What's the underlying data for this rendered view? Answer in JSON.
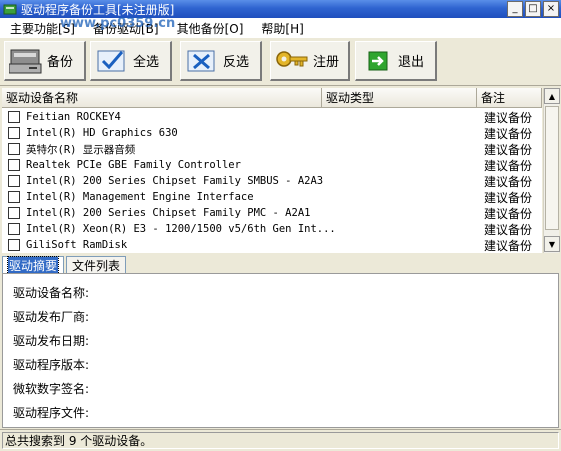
{
  "window": {
    "title": "驱动程序备份工具[未注册版]",
    "controls": [
      "_",
      "□",
      "×"
    ]
  },
  "watermark": "www.pc0359.cn",
  "menu": [
    {
      "label": "主要功能[S]"
    },
    {
      "label": "备份驱动[B]"
    },
    {
      "label": "其他备份[O]"
    },
    {
      "label": "帮助[H]"
    }
  ],
  "toolbar": {
    "backup_label": "备份",
    "select_all_label": "全选",
    "invert_label": "反选",
    "register_label": "注册",
    "exit_label": "退出"
  },
  "list": {
    "columns": [
      "驱动设备名称",
      "驱动类型",
      "备注"
    ],
    "rows": [
      {
        "name": "Feitian ROCKEY4",
        "note": "建议备份"
      },
      {
        "name": "Intel(R) HD Graphics 630",
        "note": "建议备份"
      },
      {
        "name": "英特尔(R) 显示器音频",
        "note": "建议备份"
      },
      {
        "name": "Realtek PCIe GBE Family Controller",
        "note": "建议备份"
      },
      {
        "name": "Intel(R) 200 Series Chipset Family SMBUS - A2A3",
        "note": "建议备份"
      },
      {
        "name": "Intel(R) Management Engine Interface",
        "note": "建议备份"
      },
      {
        "name": "Intel(R) 200 Series Chipset Family PMC - A2A1",
        "note": "建议备份"
      },
      {
        "name": "Intel(R) Xeon(R) E3 - 1200/1500 v5/6th Gen Int...",
        "note": "建议备份"
      },
      {
        "name": "GiliSoft RamDisk",
        "note": "建议备份"
      }
    ]
  },
  "tabs": {
    "summary": "驱动摘要",
    "files": "文件列表"
  },
  "details": {
    "device_name": "驱动设备名称:",
    "vendor": "驱动发布厂商:",
    "date": "驱动发布日期:",
    "version": "驱动程序版本:",
    "signature": "微软数字签名:",
    "files": "驱动程序文件:"
  },
  "status": "总共搜索到 9 个驱动设备。",
  "colors": {
    "titlebar": "#2f64d0",
    "window_bg": "#ece9d8",
    "selected_tab": "#316ac5"
  }
}
